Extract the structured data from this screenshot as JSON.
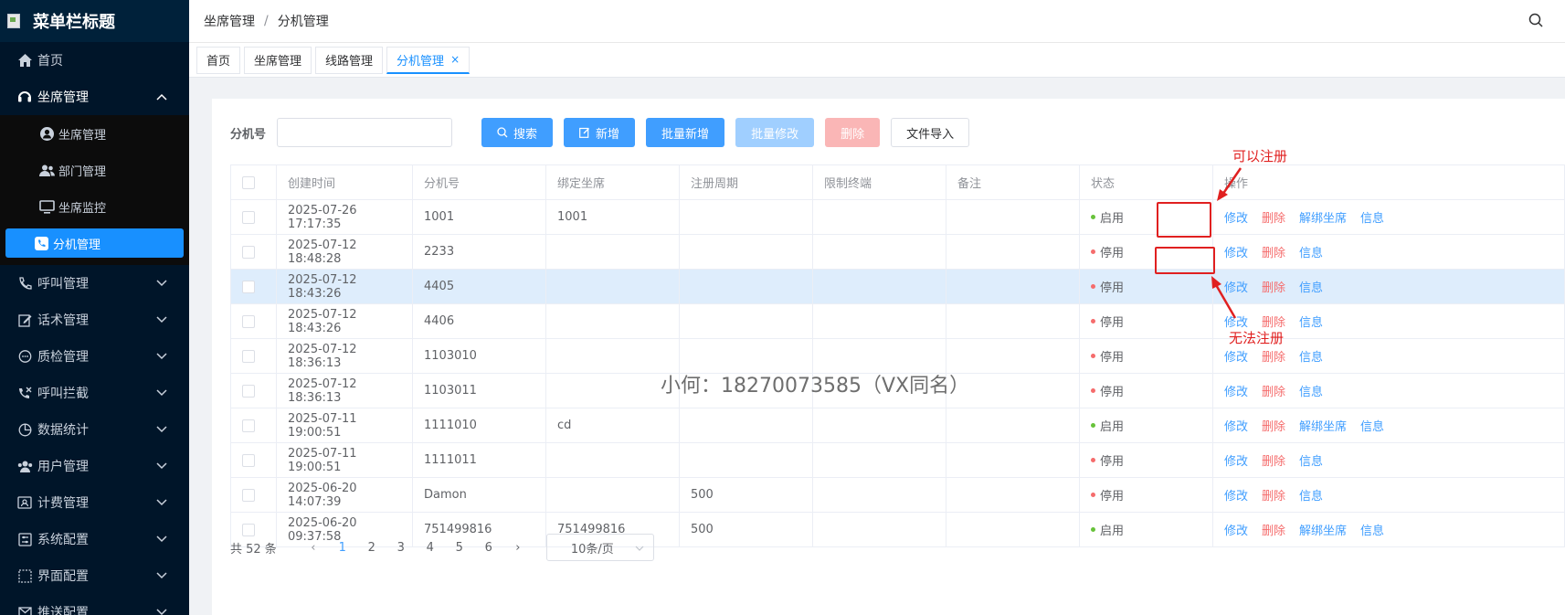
{
  "sidebar": {
    "title": "菜单栏标题",
    "items": [
      {
        "label": "首页"
      },
      {
        "label": "坐席管理"
      },
      {
        "label": "呼叫管理"
      },
      {
        "label": "话术管理"
      },
      {
        "label": "质检管理"
      },
      {
        "label": "呼叫拦截"
      },
      {
        "label": "数据统计"
      },
      {
        "label": "用户管理"
      },
      {
        "label": "计费管理"
      },
      {
        "label": "系统配置"
      },
      {
        "label": "界面配置"
      },
      {
        "label": "推送配置"
      }
    ],
    "sub_items": [
      {
        "label": "坐席管理"
      },
      {
        "label": "部门管理"
      },
      {
        "label": "坐席监控"
      },
      {
        "label": "分机管理"
      }
    ]
  },
  "header": {
    "breadcrumb": [
      "坐席管理",
      "/",
      "分机管理"
    ]
  },
  "tabs": [
    {
      "label": "首页"
    },
    {
      "label": "坐席管理"
    },
    {
      "label": "线路管理"
    },
    {
      "label": "分机管理",
      "close": "×"
    }
  ],
  "toolbar": {
    "filter_label": "分机号",
    "filter_value": "",
    "search": "搜索",
    "add": "新增",
    "batch_add": "批量新增",
    "batch_edit": "批量修改",
    "delete": "删除",
    "import": "文件导入"
  },
  "table": {
    "columns": [
      "创建时间",
      "分机号",
      "绑定坐席",
      "注册周期",
      "限制终端",
      "备注",
      "状态",
      "操作"
    ],
    "rows": [
      {
        "created": "2025-07-26 17:17:35",
        "ext": "1001",
        "seat": "1001",
        "period": "",
        "term": "",
        "note": "",
        "status": "启用",
        "enabled": true,
        "actions": [
          "修改",
          "删除",
          "解绑坐席",
          "信息"
        ]
      },
      {
        "created": "2025-07-12 18:48:28",
        "ext": "2233",
        "seat": "",
        "period": "",
        "term": "",
        "note": "",
        "status": "停用",
        "enabled": false,
        "actions": [
          "修改",
          "删除",
          "信息"
        ]
      },
      {
        "created": "2025-07-12 18:43:26",
        "ext": "4405",
        "seat": "",
        "period": "",
        "term": "",
        "note": "",
        "status": "停用",
        "enabled": false,
        "actions": [
          "修改",
          "删除",
          "信息"
        ]
      },
      {
        "created": "2025-07-12 18:43:26",
        "ext": "4406",
        "seat": "",
        "period": "",
        "term": "",
        "note": "",
        "status": "停用",
        "enabled": false,
        "actions": [
          "修改",
          "删除",
          "信息"
        ]
      },
      {
        "created": "2025-07-12 18:36:13",
        "ext": "1103010",
        "seat": "",
        "period": "",
        "term": "",
        "note": "",
        "status": "停用",
        "enabled": false,
        "actions": [
          "修改",
          "删除",
          "信息"
        ]
      },
      {
        "created": "2025-07-12 18:36:13",
        "ext": "1103011",
        "seat": "",
        "period": "",
        "term": "",
        "note": "",
        "status": "停用",
        "enabled": false,
        "actions": [
          "修改",
          "删除",
          "信息"
        ]
      },
      {
        "created": "2025-07-11 19:00:51",
        "ext": "1111010",
        "seat": "cd",
        "period": "",
        "term": "",
        "note": "",
        "status": "启用",
        "enabled": true,
        "actions": [
          "修改",
          "删除",
          "解绑坐席",
          "信息"
        ]
      },
      {
        "created": "2025-07-11 19:00:51",
        "ext": "1111011",
        "seat": "",
        "period": "",
        "term": "",
        "note": "",
        "status": "停用",
        "enabled": false,
        "actions": [
          "修改",
          "删除",
          "信息"
        ]
      },
      {
        "created": "2025-06-20 14:07:39",
        "ext": "Damon",
        "seat": "",
        "period": "500",
        "term": "",
        "note": "",
        "status": "停用",
        "enabled": false,
        "actions": [
          "修改",
          "删除",
          "信息"
        ]
      },
      {
        "created": "2025-06-20 09:37:58",
        "ext": "751499816",
        "seat": "751499816",
        "period": "500",
        "term": "",
        "note": "",
        "status": "启用",
        "enabled": true,
        "actions": [
          "修改",
          "删除",
          "解绑坐席",
          "信息"
        ]
      }
    ]
  },
  "annotations": {
    "can_register": "可以注册",
    "cannot_register": "无法注册"
  },
  "pager": {
    "total": "共 52 条",
    "prev": "‹",
    "next": "›",
    "pages": [
      "1",
      "2",
      "3",
      "4",
      "5",
      "6"
    ],
    "current": "1",
    "page_size": "10条/页"
  },
  "watermark": "小何：18270073585（VX同名）",
  "colors": {
    "sidebar_bg": "#001529",
    "accent": "#1890ff",
    "enabled_dot": "#67c23a",
    "disabled_dot": "#f56c6c",
    "annotation_red": "#e02020"
  }
}
